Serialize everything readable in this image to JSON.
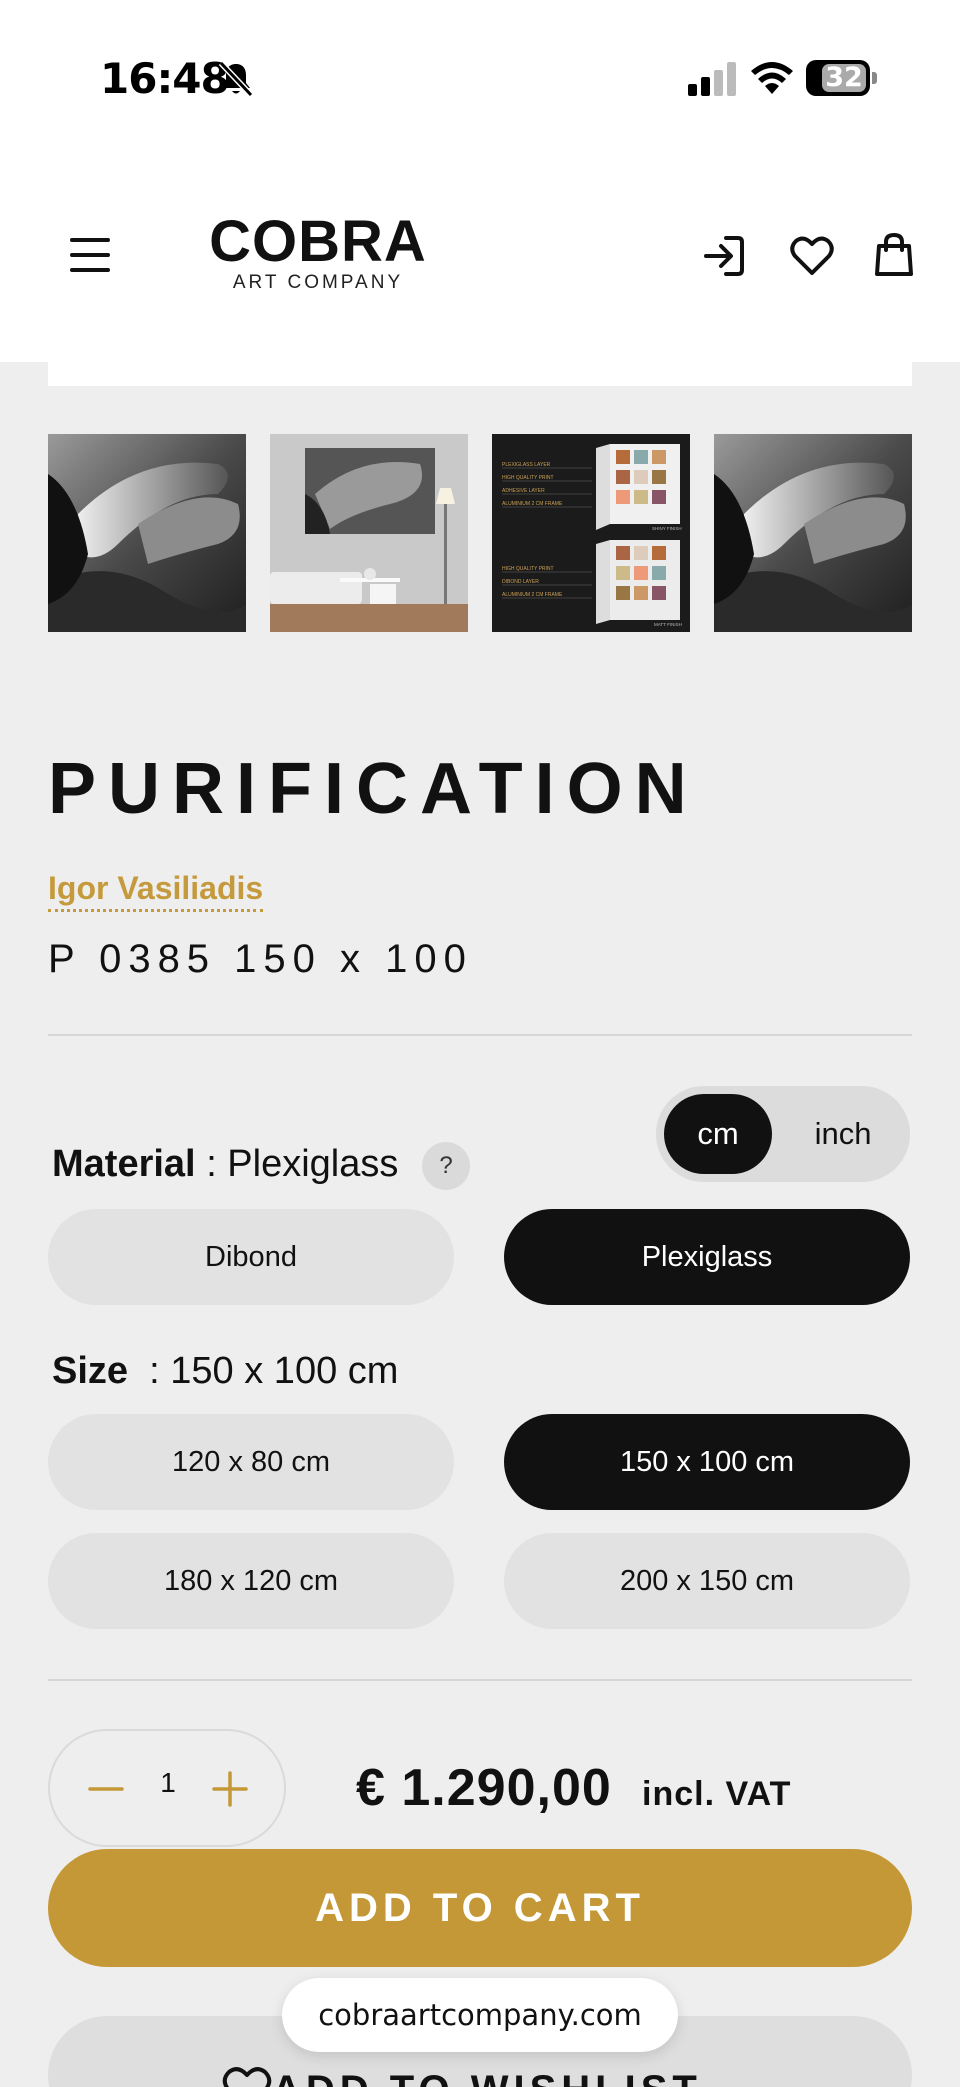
{
  "status_bar": {
    "time": "16:48",
    "battery": "32",
    "icons": [
      "bell-muted-icon",
      "signal-icon",
      "wifi-icon",
      "battery-icon"
    ]
  },
  "header": {
    "logo_main": "COBRA",
    "logo_sub": "ART COMPANY",
    "icons": [
      "menu-icon",
      "login-icon",
      "heart-icon",
      "shopping-bag-icon"
    ]
  },
  "gallery": {
    "thumbnails": [
      "thumbnail-artwork",
      "thumbnail-room-mockup",
      "thumbnail-layer-info",
      "thumbnail-artwork-2"
    ],
    "layer_info_top": [
      "PLEXIGLASS LAYER",
      "HIGH QUALITY PRINT",
      "ADHESIVE LAYER",
      "ALUMINIUM 2 CM FRAME"
    ],
    "layer_info_top_caption": "SHINY FINISH",
    "layer_info_bottom": [
      "HIGH QUALITY PRINT",
      "DIBOND LAYER",
      "ALUMINIUM 2 CM FRAME"
    ],
    "layer_info_bottom_caption": "MATT FINISH"
  },
  "product": {
    "title": "PURIFICATION",
    "artist": "Igor Vasiliadis",
    "sku": "P 0385 150 x 100"
  },
  "unit_toggle": {
    "options": [
      "cm",
      "inch"
    ],
    "selected": "cm"
  },
  "material": {
    "label": "Material",
    "value": ": Plexiglass",
    "help": "?",
    "options": [
      "Dibond",
      "Plexiglass"
    ],
    "selected": "Plexiglass"
  },
  "size": {
    "label": "Size",
    "value": ": 150 x 100 cm",
    "options": [
      "120 x 80 cm",
      "150 x 100 cm",
      "180 x 120 cm",
      "200 x 150 cm"
    ],
    "selected": "150 x 100 cm"
  },
  "purchase": {
    "quantity": "1",
    "price": "€ 1.290,00",
    "vat_note": "incl. VAT",
    "add_to_cart": "ADD TO CART",
    "wishlist": "ADD TO WISHLIST"
  },
  "browser": {
    "url": "cobraartcompany.com"
  },
  "colors": {
    "accent_gold": "#c49837",
    "selected_pill": "#111111",
    "page_background": "#eeeeee"
  }
}
